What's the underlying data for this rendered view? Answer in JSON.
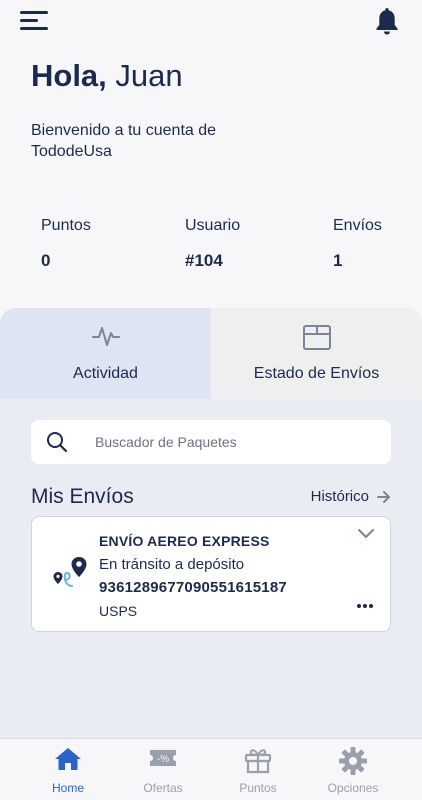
{
  "header": {
    "menu_icon": "hamburger-menu-icon",
    "notifications_icon": "bell-icon"
  },
  "greeting": {
    "hello": "Hola,",
    "name": "Juan",
    "welcome": "Bienvenido a tu cuenta de TododeUsa"
  },
  "stats": {
    "puntos_label": "Puntos",
    "puntos_value": "0",
    "usuario_label": "Usuario",
    "usuario_value": "#104",
    "envios_label": "Envíos",
    "envios_value": "1"
  },
  "tabs": [
    {
      "label": "Actividad",
      "icon": "activity-pulse-icon",
      "active": true
    },
    {
      "label": "Estado de Envíos",
      "icon": "box-icon",
      "active": false
    }
  ],
  "search": {
    "placeholder": "Buscador de Paquetes",
    "value": ""
  },
  "shipments": {
    "title": "Mis Envíos",
    "history_link": "Histórico",
    "items": [
      {
        "type": "ENVÍO AEREO EXPRESS",
        "status": "En tránsito a depósito",
        "tracking": "9361289677090551615187",
        "carrier": "USPS"
      }
    ]
  },
  "bottom_nav": [
    {
      "label": "Home",
      "icon": "home-icon",
      "active": true
    },
    {
      "label": "Ofertas",
      "icon": "discount-ticket-icon",
      "active": false
    },
    {
      "label": "Puntos",
      "icon": "gift-icon",
      "active": false
    },
    {
      "label": "Opciones",
      "icon": "gear-icon",
      "active": false
    }
  ],
  "colors": {
    "primary_text": "#1d2a4d",
    "active_nav": "#2c63c9",
    "inactive_nav": "#9aa0ab",
    "panel_bg": "#e9ecf3",
    "active_tab_bg": "#dfe4f2"
  }
}
